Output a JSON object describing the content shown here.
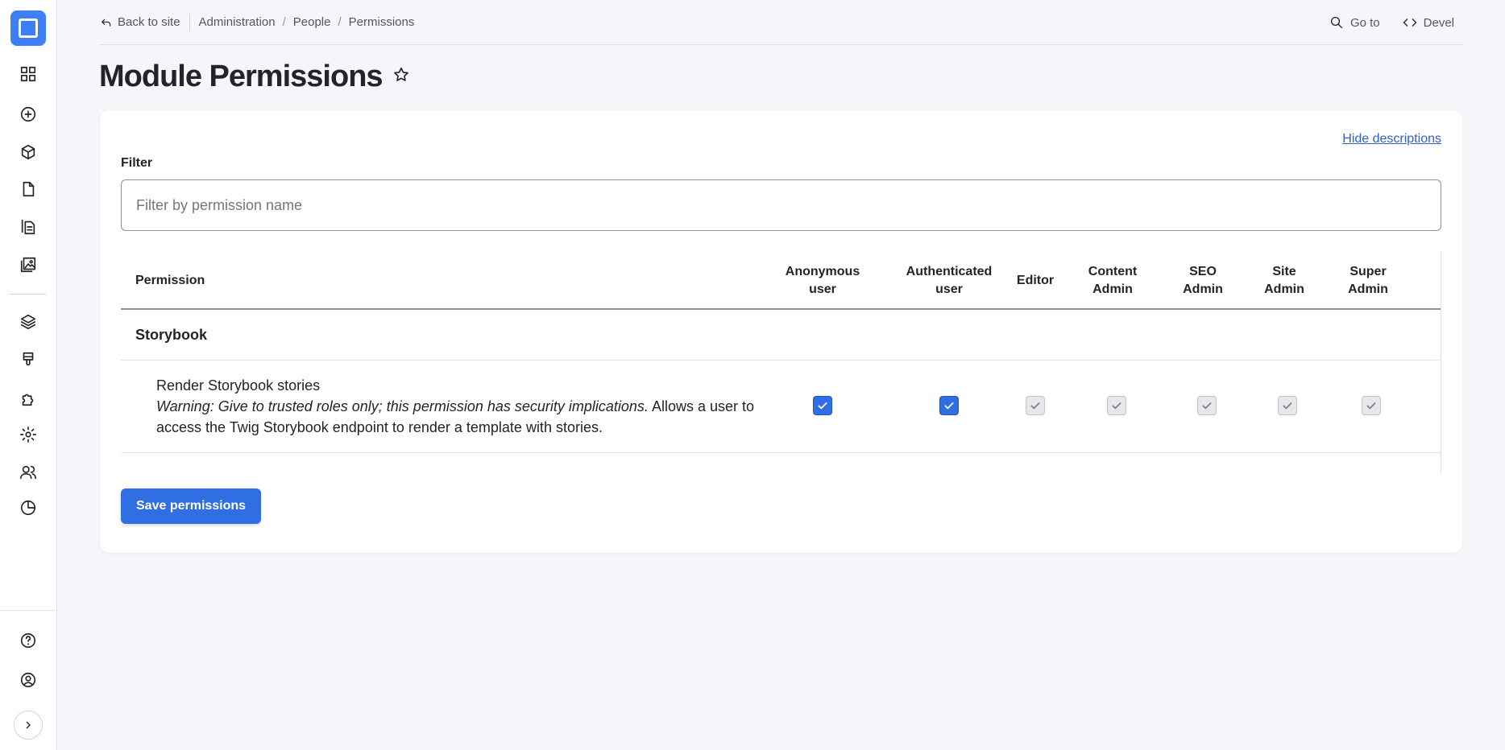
{
  "topbar": {
    "back_label": "Back to site",
    "breadcrumbs": [
      "Administration",
      "People",
      "Permissions"
    ],
    "goto_label": "Go to",
    "devel_label": "Devel"
  },
  "page": {
    "title": "Module Permissions"
  },
  "card": {
    "hide_descriptions_label": "Hide descriptions",
    "filter_label": "Filter",
    "filter_placeholder": "Filter by permission name",
    "filter_value": ""
  },
  "table": {
    "permission_header": "Permission",
    "roles": [
      {
        "line1": "Anonymous",
        "line2": "user"
      },
      {
        "line1": "Authenticated",
        "line2": "user"
      },
      {
        "line1": "Editor",
        "line2": ""
      },
      {
        "line1": "Content",
        "line2": "Admin"
      },
      {
        "line1": "SEO",
        "line2": "Admin"
      },
      {
        "line1": "Site",
        "line2": "Admin"
      },
      {
        "line1": "Super",
        "line2": "Admin"
      }
    ],
    "group_name": "Storybook",
    "permission": {
      "title": "Render Storybook stories",
      "warning": "Warning: Give to trusted roles only; this permission has security implications.",
      "description": "Allows a user to access the Twig Storybook endpoint to render a template with stories.",
      "states": [
        {
          "checked": true,
          "disabled": false
        },
        {
          "checked": true,
          "disabled": false
        },
        {
          "checked": true,
          "disabled": true
        },
        {
          "checked": true,
          "disabled": true
        },
        {
          "checked": true,
          "disabled": true
        },
        {
          "checked": true,
          "disabled": true
        },
        {
          "checked": true,
          "disabled": true
        }
      ]
    }
  },
  "actions": {
    "save_label": "Save permissions"
  },
  "sidebar": {
    "icons": [
      "dashboard-icon",
      "add-content-icon",
      "structure-icon",
      "content-icon",
      "documents-icon",
      "media-icon",
      "layers-icon",
      "appearance-icon",
      "extend-icon",
      "config-icon",
      "people-icon",
      "reports-icon",
      "help-icon",
      "user-account-icon",
      "expand-icon"
    ]
  },
  "colors": {
    "accent": "#2f6fe3",
    "logo": "#3e7ff7",
    "link": "#2d5fce"
  }
}
